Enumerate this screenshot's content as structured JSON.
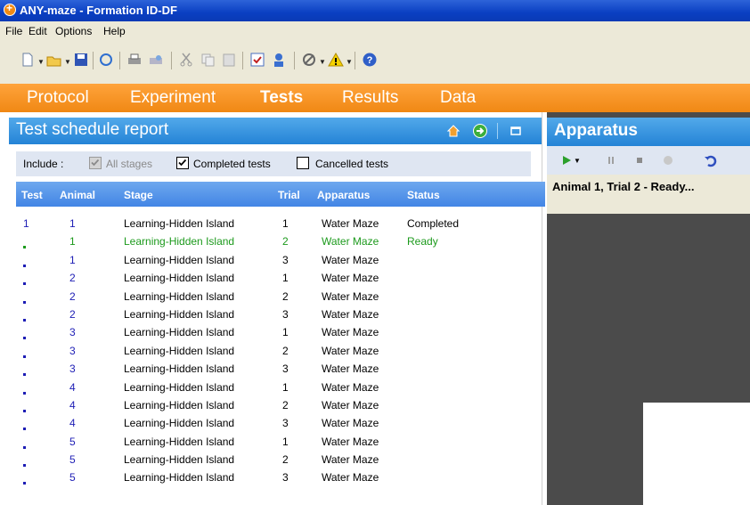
{
  "window": {
    "title": "ANY-maze - Formation ID-DF"
  },
  "menu": {
    "items": [
      "File",
      "Edit",
      "Options",
      "Help"
    ]
  },
  "nav": {
    "tabs": [
      "Protocol",
      "Experiment",
      "Tests",
      "Results",
      "Data"
    ],
    "active": "Tests"
  },
  "left_panel": {
    "title": "Test schedule report",
    "include": {
      "label": "Include :",
      "options": [
        {
          "label": "All stages",
          "checked": true,
          "enabled": false
        },
        {
          "label": "Completed tests",
          "checked": true,
          "enabled": true
        },
        {
          "label": "Cancelled tests",
          "checked": false,
          "enabled": true
        }
      ]
    },
    "columns": [
      "Test",
      "Animal",
      "Stage",
      "Trial",
      "Apparatus",
      "Status"
    ],
    "rows": [
      {
        "test": "1",
        "animal": "1",
        "stage": "Learning-Hidden Island",
        "trial": "1",
        "apparatus": "Water Maze",
        "status": "Completed"
      },
      {
        "test": "•",
        "animal": "1",
        "stage": "Learning-Hidden Island",
        "trial": "2",
        "apparatus": "Water Maze",
        "status": "Ready"
      },
      {
        "test": "•",
        "animal": "1",
        "stage": "Learning-Hidden Island",
        "trial": "3",
        "apparatus": "Water Maze",
        "status": ""
      },
      {
        "test": "•",
        "animal": "2",
        "stage": "Learning-Hidden Island",
        "trial": "1",
        "apparatus": "Water Maze",
        "status": ""
      },
      {
        "test": "•",
        "animal": "2",
        "stage": "Learning-Hidden Island",
        "trial": "2",
        "apparatus": "Water Maze",
        "status": ""
      },
      {
        "test": "•",
        "animal": "2",
        "stage": "Learning-Hidden Island",
        "trial": "3",
        "apparatus": "Water Maze",
        "status": ""
      },
      {
        "test": "•",
        "animal": "3",
        "stage": "Learning-Hidden Island",
        "trial": "1",
        "apparatus": "Water Maze",
        "status": ""
      },
      {
        "test": "•",
        "animal": "3",
        "stage": "Learning-Hidden Island",
        "trial": "2",
        "apparatus": "Water Maze",
        "status": ""
      },
      {
        "test": "•",
        "animal": "3",
        "stage": "Learning-Hidden Island",
        "trial": "3",
        "apparatus": "Water Maze",
        "status": ""
      },
      {
        "test": "•",
        "animal": "4",
        "stage": "Learning-Hidden Island",
        "trial": "1",
        "apparatus": "Water Maze",
        "status": ""
      },
      {
        "test": "•",
        "animal": "4",
        "stage": "Learning-Hidden Island",
        "trial": "2",
        "apparatus": "Water Maze",
        "status": ""
      },
      {
        "test": "•",
        "animal": "4",
        "stage": "Learning-Hidden Island",
        "trial": "3",
        "apparatus": "Water Maze",
        "status": ""
      },
      {
        "test": "•",
        "animal": "5",
        "stage": "Learning-Hidden Island",
        "trial": "1",
        "apparatus": "Water Maze",
        "status": ""
      },
      {
        "test": "•",
        "animal": "5",
        "stage": "Learning-Hidden Island",
        "trial": "2",
        "apparatus": "Water Maze",
        "status": ""
      },
      {
        "test": "•",
        "animal": "5",
        "stage": "Learning-Hidden Island",
        "trial": "3",
        "apparatus": "Water Maze",
        "status": ""
      }
    ]
  },
  "right_panel": {
    "title": "Apparatus",
    "status": "Animal 1, Trial 2 - Ready..."
  },
  "colors": {
    "nav_orange": "#f5901e",
    "panel_blue": "#3a95df",
    "ready_green": "#1c9a1c",
    "row_blue": "#1d1db5"
  },
  "icons": [
    "new-icon",
    "open-icon",
    "save-icon",
    "refresh-icon",
    "print-icon",
    "print-preview-icon",
    "cut-icon",
    "copy-icon",
    "paste-icon",
    "checklist-icon",
    "user-icon",
    "tools-icon",
    "warning-icon",
    "help-icon",
    "home-icon",
    "go-icon",
    "maximize-icon",
    "play-icon",
    "pause-icon",
    "stop-icon",
    "camera-icon",
    "undo-icon"
  ]
}
